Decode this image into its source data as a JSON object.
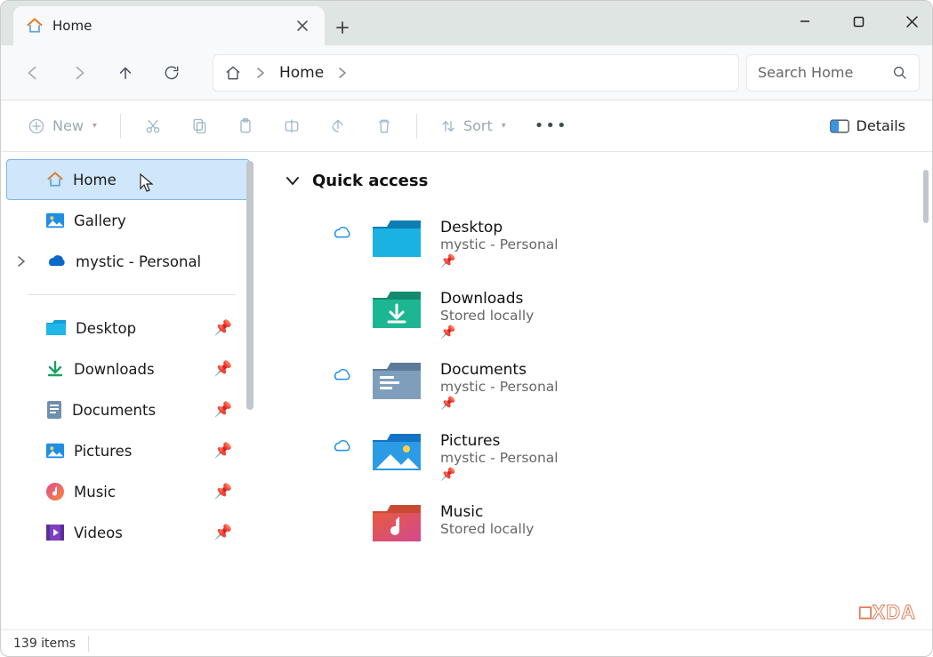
{
  "tab": {
    "title": "Home"
  },
  "address": {
    "location": "Home"
  },
  "search": {
    "placeholder": "Search Home"
  },
  "toolbar": {
    "new_label": "New",
    "sort_label": "Sort",
    "details_label": "Details"
  },
  "sidebar": {
    "items": [
      {
        "label": "Home"
      },
      {
        "label": "Gallery"
      },
      {
        "label": "mystic - Personal"
      }
    ],
    "pinned": [
      {
        "label": "Desktop"
      },
      {
        "label": "Downloads"
      },
      {
        "label": "Documents"
      },
      {
        "label": "Pictures"
      },
      {
        "label": "Music"
      },
      {
        "label": "Videos"
      }
    ]
  },
  "main": {
    "section_title": "Quick access",
    "items": [
      {
        "title": "Desktop",
        "subtitle": "mystic - Personal",
        "cloud": true
      },
      {
        "title": "Downloads",
        "subtitle": "Stored locally",
        "cloud": false
      },
      {
        "title": "Documents",
        "subtitle": "mystic - Personal",
        "cloud": true
      },
      {
        "title": "Pictures",
        "subtitle": "mystic - Personal",
        "cloud": true
      },
      {
        "title": "Music",
        "subtitle": "Stored locally",
        "cloud": false
      }
    ]
  },
  "status": {
    "items_text": "139 items"
  },
  "watermark": "□XDA"
}
